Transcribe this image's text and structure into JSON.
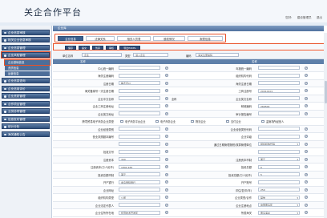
{
  "header": {
    "title": "关企合作平台",
    "user_label": "您好:",
    "user_name": "建设管理员",
    "logout": "退出"
  },
  "sidebar": {
    "items": [
      {
        "label": "企业信息审核"
      },
      {
        "label": "相关企业信息审核"
      },
      {
        "label": "企业信息管理"
      },
      {
        "label": "企业风险管理"
      }
    ],
    "subitems": [
      {
        "label": "企业基础信息"
      },
      {
        "label": "资质信息"
      },
      {
        "label": "运营信息"
      }
    ],
    "items2": [
      {
        "label": "企业信息查询"
      },
      {
        "label": "企业信用评价"
      },
      {
        "label": "企业资质管理"
      },
      {
        "label": "合作项目管理"
      },
      {
        "label": "业务协同管理"
      },
      {
        "label": "信息发布管理"
      },
      {
        "label": "统计分析"
      },
      {
        "label": "海关通知公告"
      }
    ]
  },
  "module_title": "企业库",
  "tabs": [
    "企业信息",
    "法律关系",
    "相关人员表",
    "股权情况",
    "报表信息"
  ],
  "actions": [
    "保存",
    "提交",
    "暂存",
    "审核",
    "导出EXCEL"
  ],
  "filters": {
    "name_label": "单位名称",
    "name_value": "企业",
    "type_label": "类型",
    "type_value": "进入企业",
    "code_label": "编码",
    "code_value": "海关注册编码"
  },
  "section": {
    "col1": "名称",
    "col2": "名称"
  },
  "rows": [
    {
      "l": "中心统一编码",
      "lv": "",
      "r": "年报统一编码",
      "rv": ""
    },
    {
      "l": "海关注册编码",
      "lv": "",
      "r": "组织机构代码",
      "rv": ""
    },
    {
      "l": "注册日期",
      "lv": "等不可以",
      "r": "海关注册日期",
      "rv": ""
    },
    {
      "l": "海关备案号一天注册日期",
      "lv": "",
      "r": "工商注册号",
      "rv": "20010101"
    },
    {
      "l": "企业中文名称",
      "lv": "",
      "lh": "全称",
      "r": "企业英文名称",
      "rv": ""
    },
    {
      "l": "企业工商注册地址",
      "lv": "",
      "r": "邮政编码",
      "rv": "266500"
    },
    {
      "l": "企业英文地址",
      "lv": "",
      "r": "审计报告编号",
      "rv": ""
    },
    {
      "l": "跨境贸易电子商务企业类型",
      "chk": true
    },
    {
      "l": "企业经营类别",
      "lv": "",
      "r": "企业经营类别代码",
      "rv": ""
    },
    {
      "l": "营业执照副本编号",
      "lv": "",
      "r": "企业评级",
      "rv": ""
    },
    {
      "l": "",
      "lv": "",
      "r": "通过日期管理报税/核算管理单位",
      "rv": "组织机构代码"
    },
    {
      "l": "批准文号",
      "lv": "",
      "r": "",
      "rv": ""
    },
    {
      "l": "注册资本",
      "lv": "300",
      "r": "注册资本币制",
      "rv": "美元"
    },
    {
      "l": "注册资本(万人民币)",
      "lv": "1894.183",
      "r": "投资总额",
      "rv": "0"
    },
    {
      "l": "投资总额币制",
      "lv": "美元",
      "r": "投资总额(万人民币)",
      "rv": "5"
    },
    {
      "l": "开户银行",
      "lv": "青岛国际银行",
      "r": "开户账号",
      "rv": ""
    },
    {
      "l": "企业网址",
      "lv": "",
      "r": "评估/复评(年)",
      "rv": "250"
    },
    {
      "l": "组织机构类型",
      "lv": "公司",
      "r": "企业类型/合作",
      "rv": "其他"
    },
    {
      "l": "企业法定代表人",
      "lv": "",
      "r": "企业注册地点",
      "rv": "中国黄岛区"
    },
    {
      "l": "企业住所所在地",
      "lv": "经济技术开发区",
      "r": "所属海关",
      "rv": "黄岛海关"
    }
  ],
  "checkbox_options": [
    "电子商务平台企业",
    "电子商务企业",
    "物流企业",
    "支付企业",
    "监管场所经营人"
  ]
}
